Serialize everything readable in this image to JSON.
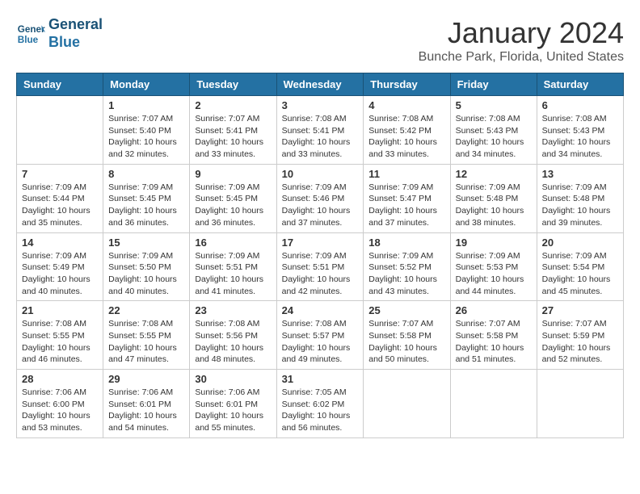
{
  "header": {
    "logo_line1": "General",
    "logo_line2": "Blue",
    "month": "January 2024",
    "location": "Bunche Park, Florida, United States"
  },
  "days_of_week": [
    "Sunday",
    "Monday",
    "Tuesday",
    "Wednesday",
    "Thursday",
    "Friday",
    "Saturday"
  ],
  "weeks": [
    [
      {
        "day": "",
        "sunrise": "",
        "sunset": "",
        "daylight": ""
      },
      {
        "day": "1",
        "sunrise": "Sunrise: 7:07 AM",
        "sunset": "Sunset: 5:40 PM",
        "daylight": "Daylight: 10 hours and 32 minutes."
      },
      {
        "day": "2",
        "sunrise": "Sunrise: 7:07 AM",
        "sunset": "Sunset: 5:41 PM",
        "daylight": "Daylight: 10 hours and 33 minutes."
      },
      {
        "day": "3",
        "sunrise": "Sunrise: 7:08 AM",
        "sunset": "Sunset: 5:41 PM",
        "daylight": "Daylight: 10 hours and 33 minutes."
      },
      {
        "day": "4",
        "sunrise": "Sunrise: 7:08 AM",
        "sunset": "Sunset: 5:42 PM",
        "daylight": "Daylight: 10 hours and 33 minutes."
      },
      {
        "day": "5",
        "sunrise": "Sunrise: 7:08 AM",
        "sunset": "Sunset: 5:43 PM",
        "daylight": "Daylight: 10 hours and 34 minutes."
      },
      {
        "day": "6",
        "sunrise": "Sunrise: 7:08 AM",
        "sunset": "Sunset: 5:43 PM",
        "daylight": "Daylight: 10 hours and 34 minutes."
      }
    ],
    [
      {
        "day": "7",
        "sunrise": "Sunrise: 7:09 AM",
        "sunset": "Sunset: 5:44 PM",
        "daylight": "Daylight: 10 hours and 35 minutes."
      },
      {
        "day": "8",
        "sunrise": "Sunrise: 7:09 AM",
        "sunset": "Sunset: 5:45 PM",
        "daylight": "Daylight: 10 hours and 36 minutes."
      },
      {
        "day": "9",
        "sunrise": "Sunrise: 7:09 AM",
        "sunset": "Sunset: 5:45 PM",
        "daylight": "Daylight: 10 hours and 36 minutes."
      },
      {
        "day": "10",
        "sunrise": "Sunrise: 7:09 AM",
        "sunset": "Sunset: 5:46 PM",
        "daylight": "Daylight: 10 hours and 37 minutes."
      },
      {
        "day": "11",
        "sunrise": "Sunrise: 7:09 AM",
        "sunset": "Sunset: 5:47 PM",
        "daylight": "Daylight: 10 hours and 37 minutes."
      },
      {
        "day": "12",
        "sunrise": "Sunrise: 7:09 AM",
        "sunset": "Sunset: 5:48 PM",
        "daylight": "Daylight: 10 hours and 38 minutes."
      },
      {
        "day": "13",
        "sunrise": "Sunrise: 7:09 AM",
        "sunset": "Sunset: 5:48 PM",
        "daylight": "Daylight: 10 hours and 39 minutes."
      }
    ],
    [
      {
        "day": "14",
        "sunrise": "Sunrise: 7:09 AM",
        "sunset": "Sunset: 5:49 PM",
        "daylight": "Daylight: 10 hours and 40 minutes."
      },
      {
        "day": "15",
        "sunrise": "Sunrise: 7:09 AM",
        "sunset": "Sunset: 5:50 PM",
        "daylight": "Daylight: 10 hours and 40 minutes."
      },
      {
        "day": "16",
        "sunrise": "Sunrise: 7:09 AM",
        "sunset": "Sunset: 5:51 PM",
        "daylight": "Daylight: 10 hours and 41 minutes."
      },
      {
        "day": "17",
        "sunrise": "Sunrise: 7:09 AM",
        "sunset": "Sunset: 5:51 PM",
        "daylight": "Daylight: 10 hours and 42 minutes."
      },
      {
        "day": "18",
        "sunrise": "Sunrise: 7:09 AM",
        "sunset": "Sunset: 5:52 PM",
        "daylight": "Daylight: 10 hours and 43 minutes."
      },
      {
        "day": "19",
        "sunrise": "Sunrise: 7:09 AM",
        "sunset": "Sunset: 5:53 PM",
        "daylight": "Daylight: 10 hours and 44 minutes."
      },
      {
        "day": "20",
        "sunrise": "Sunrise: 7:09 AM",
        "sunset": "Sunset: 5:54 PM",
        "daylight": "Daylight: 10 hours and 45 minutes."
      }
    ],
    [
      {
        "day": "21",
        "sunrise": "Sunrise: 7:08 AM",
        "sunset": "Sunset: 5:55 PM",
        "daylight": "Daylight: 10 hours and 46 minutes."
      },
      {
        "day": "22",
        "sunrise": "Sunrise: 7:08 AM",
        "sunset": "Sunset: 5:55 PM",
        "daylight": "Daylight: 10 hours and 47 minutes."
      },
      {
        "day": "23",
        "sunrise": "Sunrise: 7:08 AM",
        "sunset": "Sunset: 5:56 PM",
        "daylight": "Daylight: 10 hours and 48 minutes."
      },
      {
        "day": "24",
        "sunrise": "Sunrise: 7:08 AM",
        "sunset": "Sunset: 5:57 PM",
        "daylight": "Daylight: 10 hours and 49 minutes."
      },
      {
        "day": "25",
        "sunrise": "Sunrise: 7:07 AM",
        "sunset": "Sunset: 5:58 PM",
        "daylight": "Daylight: 10 hours and 50 minutes."
      },
      {
        "day": "26",
        "sunrise": "Sunrise: 7:07 AM",
        "sunset": "Sunset: 5:58 PM",
        "daylight": "Daylight: 10 hours and 51 minutes."
      },
      {
        "day": "27",
        "sunrise": "Sunrise: 7:07 AM",
        "sunset": "Sunset: 5:59 PM",
        "daylight": "Daylight: 10 hours and 52 minutes."
      }
    ],
    [
      {
        "day": "28",
        "sunrise": "Sunrise: 7:06 AM",
        "sunset": "Sunset: 6:00 PM",
        "daylight": "Daylight: 10 hours and 53 minutes."
      },
      {
        "day": "29",
        "sunrise": "Sunrise: 7:06 AM",
        "sunset": "Sunset: 6:01 PM",
        "daylight": "Daylight: 10 hours and 54 minutes."
      },
      {
        "day": "30",
        "sunrise": "Sunrise: 7:06 AM",
        "sunset": "Sunset: 6:01 PM",
        "daylight": "Daylight: 10 hours and 55 minutes."
      },
      {
        "day": "31",
        "sunrise": "Sunrise: 7:05 AM",
        "sunset": "Sunset: 6:02 PM",
        "daylight": "Daylight: 10 hours and 56 minutes."
      },
      {
        "day": "",
        "sunrise": "",
        "sunset": "",
        "daylight": ""
      },
      {
        "day": "",
        "sunrise": "",
        "sunset": "",
        "daylight": ""
      },
      {
        "day": "",
        "sunrise": "",
        "sunset": "",
        "daylight": ""
      }
    ]
  ]
}
